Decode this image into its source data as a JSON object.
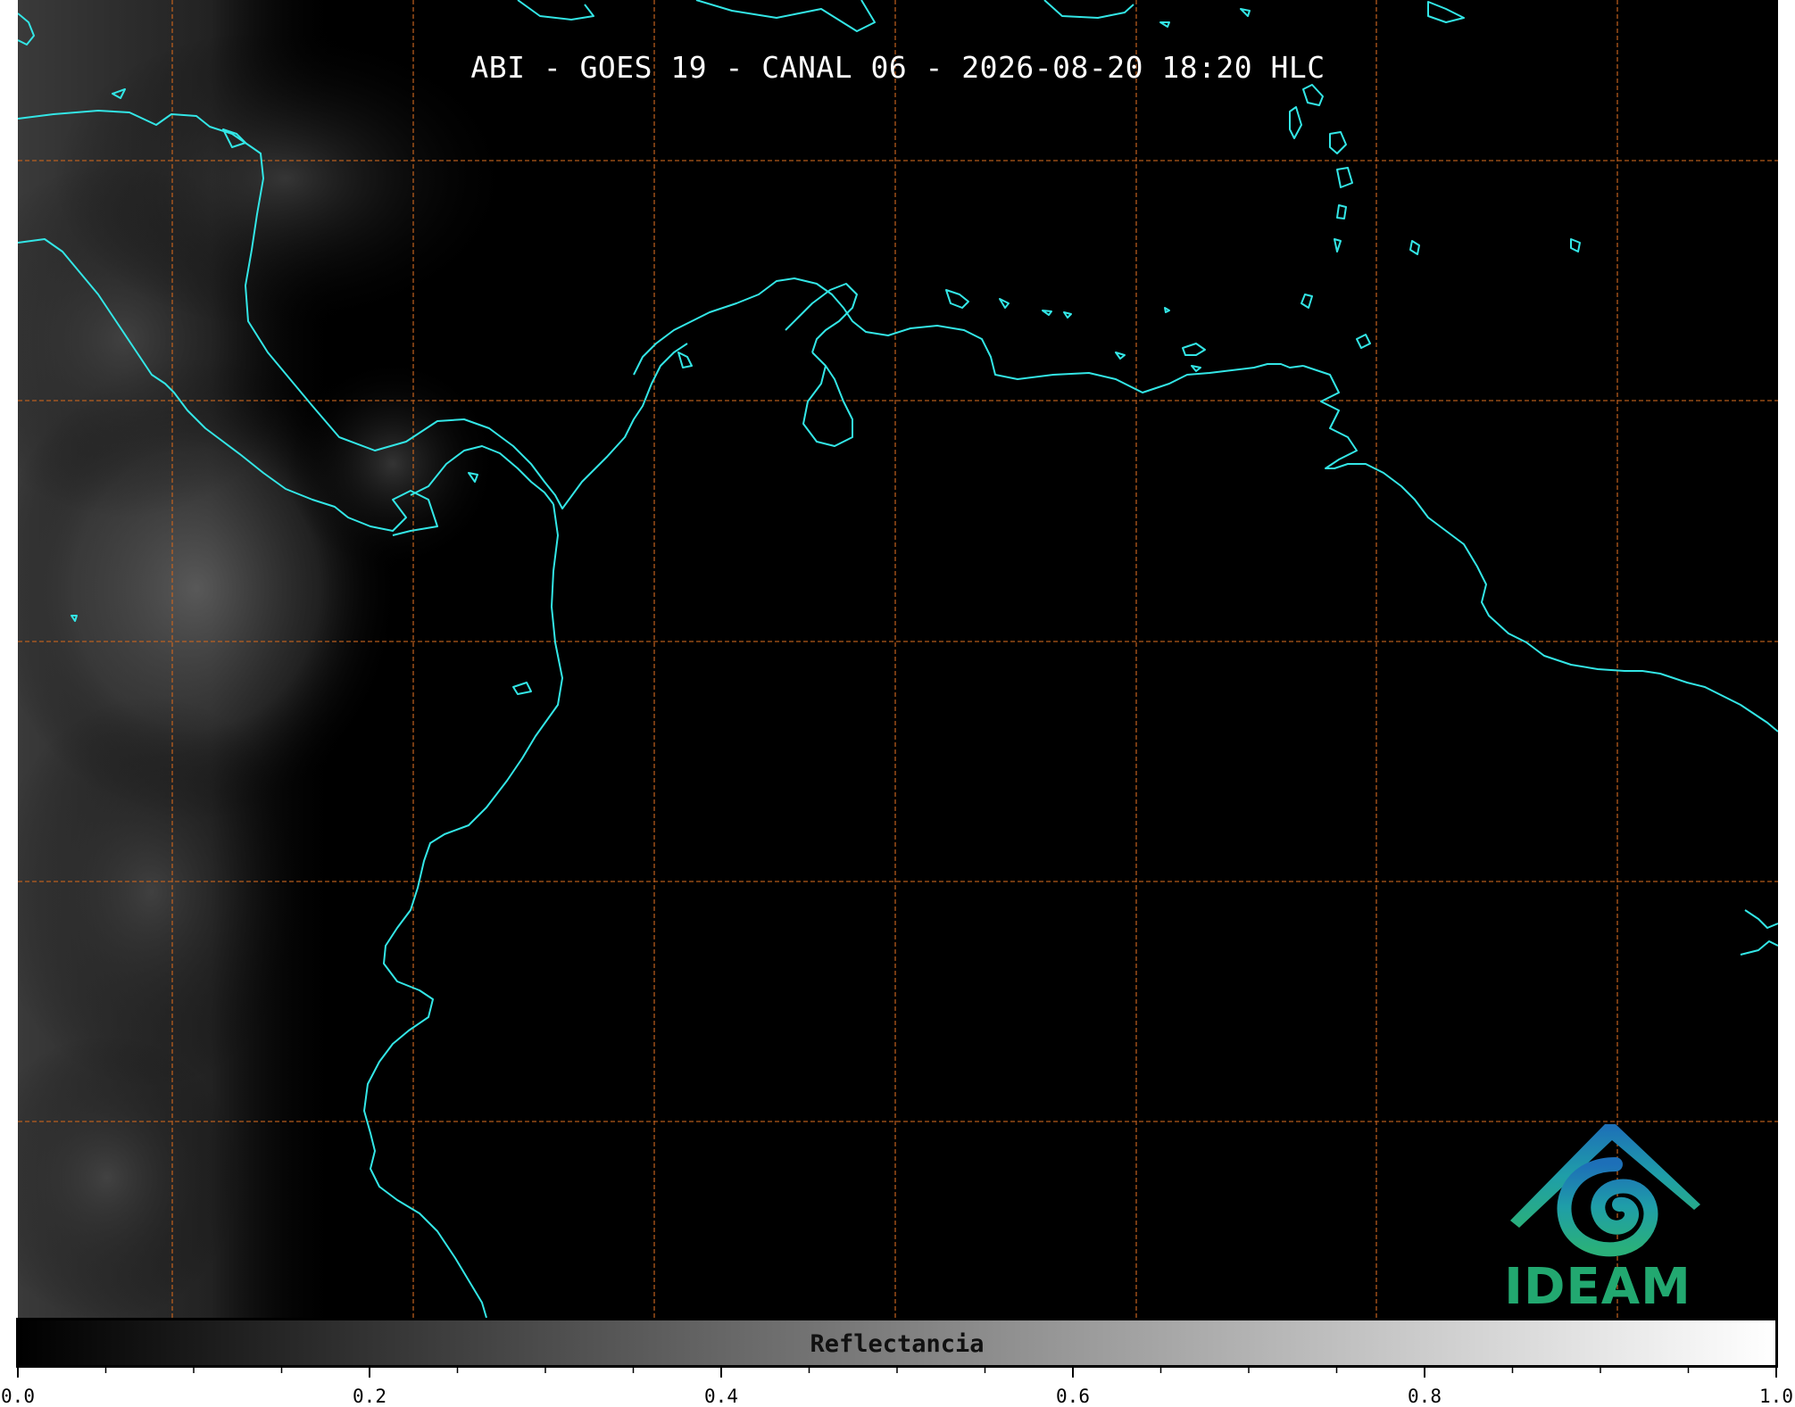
{
  "map": {
    "title": "ABI - GOES 19 - CANAL 06 - 2026-08-20 18:20 HLC",
    "background_color": "#000000",
    "coastline_color": "#33e6e6",
    "gridline_color": "#c8641e",
    "gridline_style": "dashed"
  },
  "logo": {
    "text": "IDEAM",
    "text_color": "#22a870",
    "gradient_colors": [
      "#1d6fb8",
      "#1f9ea8",
      "#2ab07a"
    ]
  },
  "colorbar": {
    "label": "Reflectancia",
    "range": [
      0.0,
      1.0
    ],
    "colormap": "gray",
    "gradient_start": "#000000",
    "gradient_end": "#ffffff",
    "tick_labels": [
      "0.0",
      "0.2",
      "0.4",
      "0.6",
      "0.8",
      "1.0"
    ],
    "major_ticks": [
      0.0,
      0.2,
      0.4,
      0.6,
      0.8,
      1.0
    ],
    "minor_tick_step": 0.05
  }
}
